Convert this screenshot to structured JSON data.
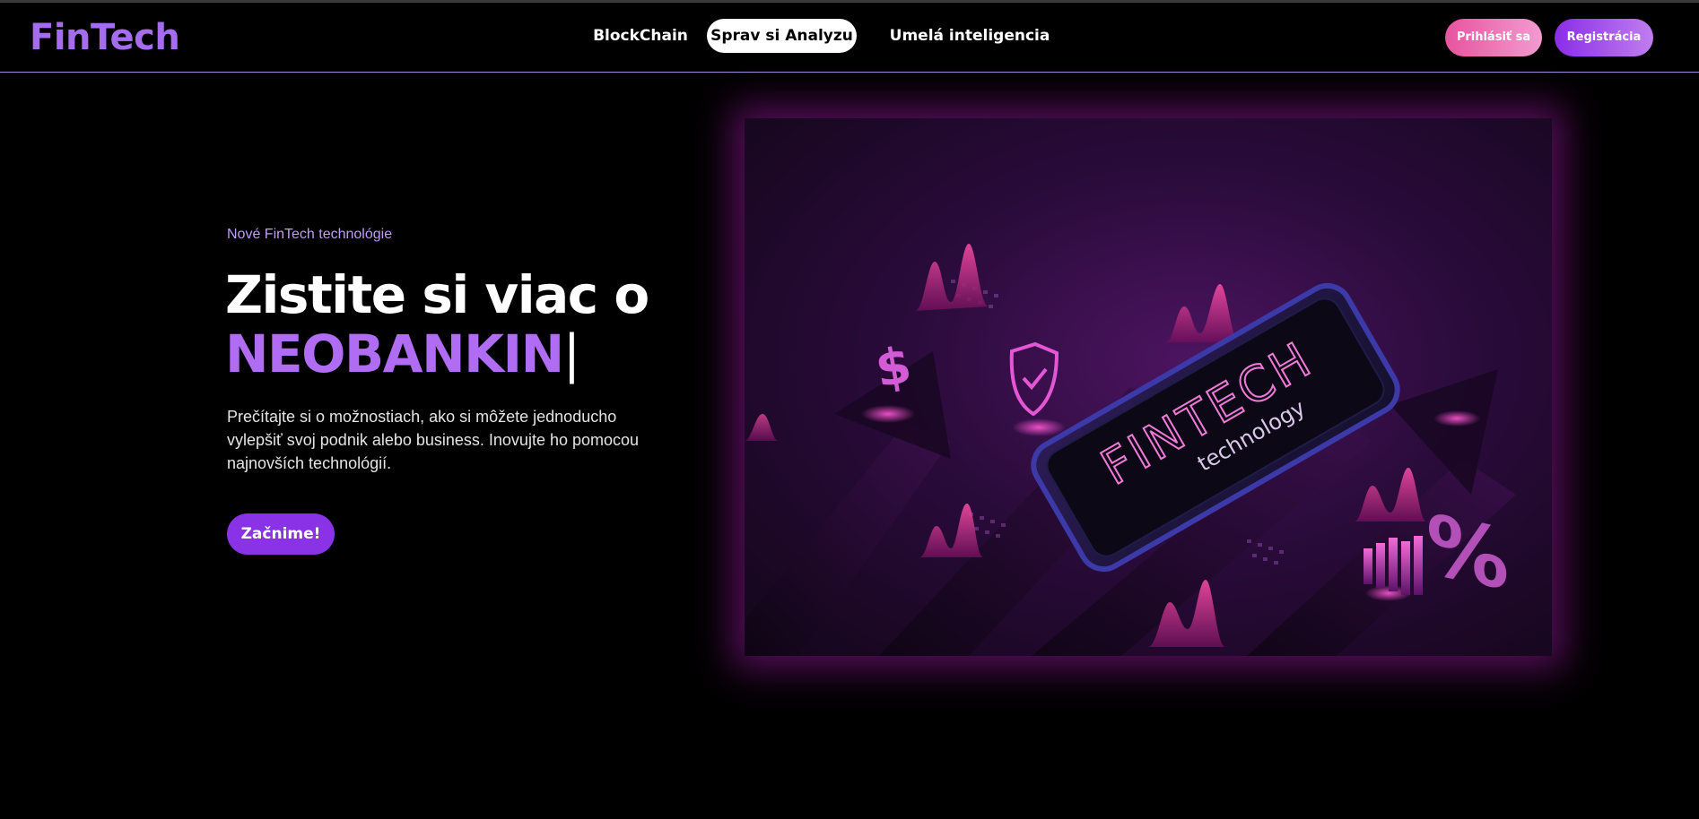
{
  "brand": {
    "logo": "FinTech"
  },
  "nav": {
    "items": [
      {
        "label": "BlockChain",
        "active": false
      },
      {
        "label": "Sprav si Analyzu",
        "active": true
      },
      {
        "label": "Umelá inteligencia",
        "active": false
      }
    ]
  },
  "auth": {
    "login_label": "Prihlásiť sa",
    "register_label": "Registrácia"
  },
  "hero": {
    "eyebrow": "Nové FinTech technológie",
    "headline_line1": "Zistite si viac o",
    "headline_highlight": "NEOBANKIN",
    "caret": "|",
    "description": "Prečítajte si o možnostiach, ako si môžete jednoducho vylepšiť svoj podnik alebo business. Inovujte ho pomocou najnovších technológií.",
    "cta_label": "Začnime!"
  },
  "illustration": {
    "phone_title": "FINTECH",
    "phone_subtitle": "technology",
    "icons": [
      "dollar-icon",
      "shield-check-icon",
      "percent-icon",
      "bar-chart-icon"
    ]
  },
  "colors": {
    "background": "#000000",
    "logo": "#a66cf0",
    "highlight": "#b06cf2",
    "login_gradient": [
      "#e8539e",
      "#f29bd1"
    ],
    "register_gradient": [
      "#8a2de6",
      "#c07ef0"
    ],
    "cta": "#8a33e6"
  }
}
